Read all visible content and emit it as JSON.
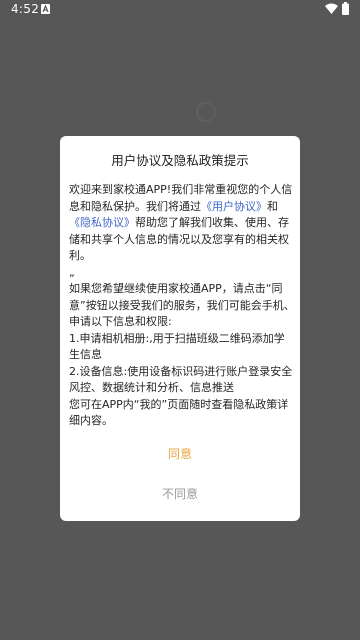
{
  "status_bar": {
    "time": "4:52",
    "icons": [
      "notification-a-icon",
      "wifi-icon",
      "battery-icon"
    ]
  },
  "dialog": {
    "title": "用户协议及隐私政策提示",
    "body": {
      "intro_1": "欢迎来到家校通APP!我们非常重视您的个人信息和隐私保护。我们将通过",
      "link_user_agreement": "《用户协议》",
      "intro_2": "和",
      "link_privacy_agreement": "《隐私协议》",
      "intro_3": "帮助您了解我们收集、使用、存储和共享个人信息的情况以及您享有的相关权利。",
      "stray_mark": "„",
      "paragraph_2": "如果您希望继续使用家校通APP，请点击“同意”按钮以接受我们的服务，我们可能会手机、申请以下信息和权限:",
      "item_1": "1.申请相机相册:,用于扫描班级二维码添加学生信息",
      "item_2": "2.设备信息:使用设备标识码进行账户登录安全风控、数据统计和分析、信息推送",
      "closing": "您可在APP内“我的”页面随时查看隐私政策详细内容。"
    },
    "agree_label": "同意",
    "disagree_label": "不同意"
  },
  "colors": {
    "backdrop": "#575757",
    "dialog_bg": "#ffffff",
    "link": "#3f66c9",
    "agree": "#e9a440",
    "disagree": "#9a9a9a"
  }
}
